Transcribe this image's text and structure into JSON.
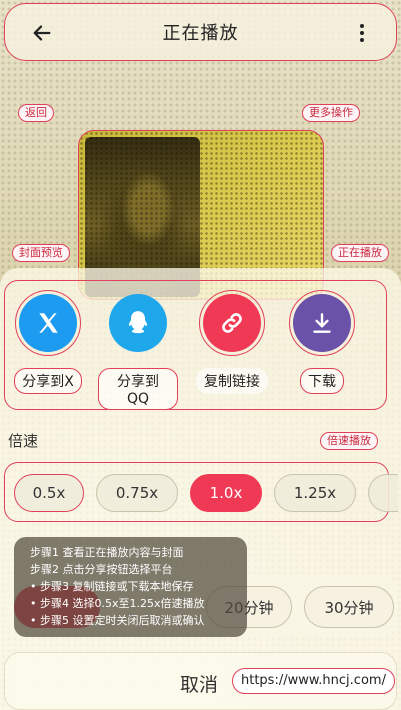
{
  "header": {
    "title": "正在播放"
  },
  "annotations": {
    "back": "返回",
    "more": "更多操作",
    "cover": "封面预览",
    "now_playing": "正在播放",
    "speed": "倍速播放"
  },
  "share": [
    {
      "label": "分享到X",
      "icon": "x-logo-icon",
      "color": "#1d9bf0"
    },
    {
      "label": "分享到QQ",
      "icon": "qq-penguin-icon",
      "color": "#1fa7ec"
    },
    {
      "label": "复制链接",
      "icon": "link-icon",
      "color": "#f03a55"
    },
    {
      "label": "下载",
      "icon": "download-icon",
      "color": "#6a52a8"
    }
  ],
  "speed": {
    "label": "倍速",
    "options": [
      "0.5x",
      "0.75x",
      "1.0x",
      "1.25x"
    ],
    "selected": "1.0x"
  },
  "timer": {
    "options": [
      "20分钟",
      "30分钟"
    ]
  },
  "steps": [
    "步骤1 查看正在播放内容与封面",
    "步骤2 点击分享按钮选择平台",
    "• 步骤3 复制链接或下载本地保存",
    "• 步骤4 选择0.5x至1.25x倍速播放",
    "• 步骤5 设置定时关闭后取消或确认"
  ],
  "footer": {
    "cancel_label": "取消",
    "url": "https://www.hncj.com/"
  }
}
